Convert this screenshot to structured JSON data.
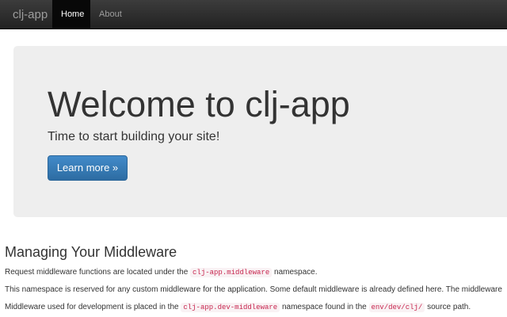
{
  "navbar": {
    "brand": "clj-app",
    "links": [
      {
        "label": "Home",
        "active": true
      },
      {
        "label": "About",
        "active": false
      }
    ]
  },
  "jumbotron": {
    "title": "Welcome to clj-app",
    "subtitle": "Time to start building your site!",
    "button_label": "Learn more »"
  },
  "middleware": {
    "heading": "Managing Your Middleware",
    "p1": {
      "before": "Request middleware functions are located under the",
      "code": "clj-app.middleware",
      "after": "namespace."
    },
    "p2": "This namespace is reserved for any custom middleware for the application. Some default middleware is already defined here. The middleware",
    "p3": {
      "before": "Middleware used for development is placed in the",
      "code1": "clj-app.dev-middleware",
      "middle": "namespace found in the",
      "code2": "env/dev/clj/",
      "after": "source path."
    }
  },
  "colors": {
    "navbar_bg": "#222222",
    "jumbotron_bg": "#eeeeee",
    "primary": "#428bca",
    "code_text": "#c7254e"
  }
}
